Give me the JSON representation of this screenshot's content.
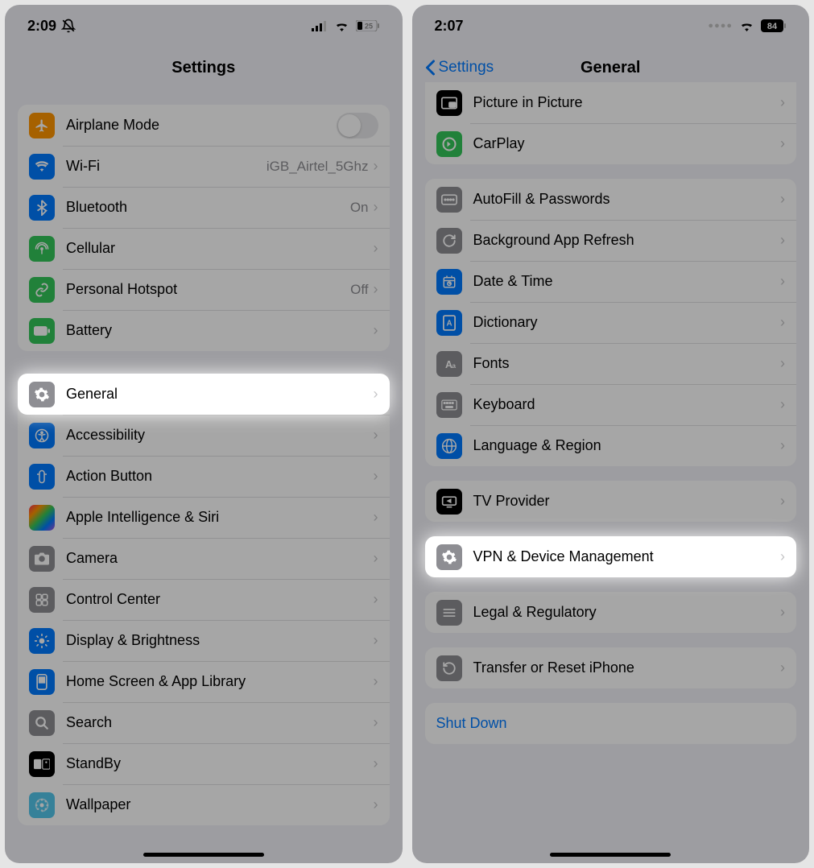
{
  "left": {
    "status": {
      "time": "2:09",
      "battery": "25"
    },
    "title": "Settings",
    "groups": [
      [
        {
          "icon": "airplane",
          "bg": "#ff9500",
          "label": "Airplane Mode",
          "control": "toggle"
        },
        {
          "icon": "wifi",
          "bg": "#007aff",
          "label": "Wi-Fi",
          "value": "iGB_Airtel_5Ghz",
          "chev": true
        },
        {
          "icon": "bluetooth",
          "bg": "#007aff",
          "label": "Bluetooth",
          "value": "On",
          "chev": true
        },
        {
          "icon": "antenna",
          "bg": "#34c759",
          "label": "Cellular",
          "chev": true
        },
        {
          "icon": "link",
          "bg": "#34c759",
          "label": "Personal Hotspot",
          "value": "Off",
          "chev": true
        },
        {
          "icon": "battery",
          "bg": "#34c759",
          "label": "Battery",
          "chev": true
        }
      ],
      [
        {
          "icon": "gear",
          "bg": "#8e8e93",
          "label": "General",
          "chev": true,
          "hl": true
        },
        {
          "icon": "access",
          "bg": "#007aff",
          "label": "Accessibility",
          "chev": true
        },
        {
          "icon": "action",
          "bg": "#007aff",
          "label": "Action Button",
          "chev": true
        },
        {
          "icon": "siri",
          "bg": "grad",
          "label": "Apple Intelligence & Siri",
          "chev": true
        },
        {
          "icon": "camera",
          "bg": "#8e8e93",
          "label": "Camera",
          "chev": true
        },
        {
          "icon": "cc",
          "bg": "#8e8e93",
          "label": "Control Center",
          "chev": true
        },
        {
          "icon": "sun",
          "bg": "#007aff",
          "label": "Display & Brightness",
          "chev": true
        },
        {
          "icon": "apps",
          "bg": "#007aff",
          "label": "Home Screen & App Library",
          "chev": true
        },
        {
          "icon": "search",
          "bg": "#8e8e93",
          "label": "Search",
          "chev": true
        },
        {
          "icon": "standby",
          "bg": "#000000",
          "label": "StandBy",
          "chev": true
        },
        {
          "icon": "wallpaper",
          "bg": "#54c7ec",
          "label": "Wallpaper",
          "chev": true
        }
      ]
    ]
  },
  "right": {
    "status": {
      "time": "2:07",
      "battery": "84"
    },
    "back": "Settings",
    "title": "General",
    "groups": [
      [
        {
          "icon": "pip",
          "bg": "#000000",
          "label": "Picture in Picture",
          "chev": true
        },
        {
          "icon": "carplay",
          "bg": "#34c759",
          "label": "CarPlay",
          "chev": true
        }
      ],
      [
        {
          "icon": "autofill",
          "bg": "#8e8e93",
          "label": "AutoFill & Passwords",
          "chev": true
        },
        {
          "icon": "refresh",
          "bg": "#8e8e93",
          "label": "Background App Refresh",
          "chev": true
        },
        {
          "icon": "clock",
          "bg": "#007aff",
          "label": "Date & Time",
          "chev": true
        },
        {
          "icon": "dict",
          "bg": "#007aff",
          "label": "Dictionary",
          "chev": true
        },
        {
          "icon": "fonts",
          "bg": "#8e8e93",
          "label": "Fonts",
          "chev": true
        },
        {
          "icon": "keyboard",
          "bg": "#8e8e93",
          "label": "Keyboard",
          "chev": true
        },
        {
          "icon": "globe",
          "bg": "#007aff",
          "label": "Language & Region",
          "chev": true
        }
      ],
      [
        {
          "icon": "tv",
          "bg": "#000000",
          "label": "TV Provider",
          "chev": true
        }
      ],
      [
        {
          "icon": "gear",
          "bg": "#8e8e93",
          "label": "VPN & Device Management",
          "chev": true,
          "hl": true
        }
      ],
      [
        {
          "icon": "legal",
          "bg": "#8e8e93",
          "label": "Legal & Regulatory",
          "chev": true
        }
      ],
      [
        {
          "icon": "reset",
          "bg": "#8e8e93",
          "label": "Transfer or Reset iPhone",
          "chev": true
        }
      ],
      [
        {
          "label": "Shut Down",
          "shutdown": true
        }
      ]
    ]
  }
}
